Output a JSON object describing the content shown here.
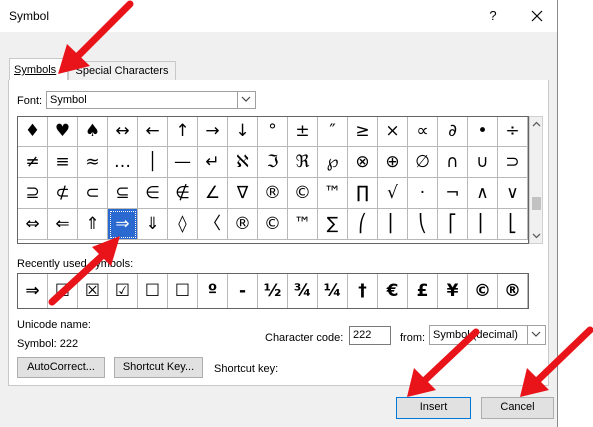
{
  "window": {
    "title": "Symbol",
    "help_label": "?"
  },
  "tabs": [
    {
      "label": "Symbols",
      "active": true
    },
    {
      "label": "Special Characters",
      "active": false
    }
  ],
  "font": {
    "label": "Font:",
    "value": "Symbol"
  },
  "symbol_grid": {
    "rows": [
      [
        "♦",
        "♥",
        "♠",
        "↔",
        "←",
        "↑",
        "→",
        "↓",
        "°",
        "±",
        "″",
        "≥",
        "×",
        "∝",
        "∂",
        "•",
        "÷"
      ],
      [
        "≠",
        "≡",
        "≈",
        "…",
        "│",
        "—",
        "↵",
        "ℵ",
        "ℑ",
        "ℜ",
        "℘",
        "⊗",
        "⊕",
        "∅",
        "∩",
        "∪",
        "⊃"
      ],
      [
        "⊇",
        "⊄",
        "⊂",
        "⊆",
        "∈",
        "∉",
        "∠",
        "∇",
        "®",
        "©",
        "™",
        "∏",
        "√",
        "·",
        "¬",
        "∧",
        "∨"
      ],
      [
        "⇔",
        "⇐",
        "⇑",
        "⇒",
        "⇓",
        "◊",
        "〈",
        "®",
        "©",
        "™",
        "∑",
        "⎛",
        "⎜",
        "⎝",
        "⎡",
        "⎢",
        "⎣"
      ]
    ],
    "selected": {
      "row": 3,
      "col": 3
    }
  },
  "recently_used": {
    "label": "Recently used symbols:",
    "items": [
      "⇒",
      "☐",
      "☒",
      "☑",
      "☐",
      "☐",
      "º",
      "-",
      "½",
      "¾",
      "¼",
      "†",
      "€",
      "£",
      "¥",
      "©",
      "®"
    ]
  },
  "unicode": {
    "name_label": "Unicode name:",
    "value": "Symbol: 222"
  },
  "character_code": {
    "label": "Character code:",
    "value": "222"
  },
  "from": {
    "label": "from:",
    "value": "Symbol (decimal)"
  },
  "buttons": {
    "autocorrect": "AutoCorrect...",
    "shortcut_key": "Shortcut Key...",
    "insert": "Insert",
    "cancel": "Cancel"
  },
  "shortcut_key_label": "Shortcut key:",
  "colors": {
    "selected_cell": "#2a6ad0",
    "annotation_arrow": "#e8141a",
    "default_button_border": "#0078d7"
  }
}
